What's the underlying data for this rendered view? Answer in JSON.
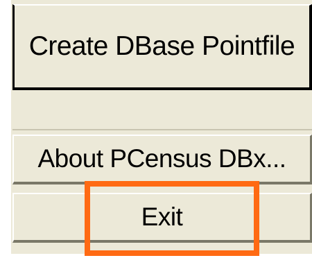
{
  "menu": {
    "create_dbase_label": "Create DBase Pointfile",
    "about_label": "About PCensus DBx...",
    "exit_label": "Exit"
  },
  "colors": {
    "face": "#ece9d8",
    "highlight": "#ff6a13"
  }
}
